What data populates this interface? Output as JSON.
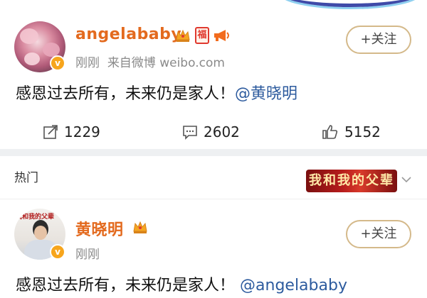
{
  "post1": {
    "username": "angelababy",
    "badge_fu": "福",
    "time": "刚刚",
    "source": "来自微博 weibo.com",
    "follow_label": "+关注",
    "text": "感恩过去所有，未来仍是家人！",
    "mention": "@黄晓明",
    "share_count": "1229",
    "comment_count": "2602",
    "like_count": "5152"
  },
  "hot_section": {
    "label": "热门",
    "banner_text": "我和我的父辈"
  },
  "post2": {
    "username": "黄晓明",
    "avatar_tag": "我和我的父辈",
    "time": "刚刚",
    "follow_label": "+关注",
    "text": "感恩过去所有，未来仍是家人！",
    "mention": "@angelababy"
  },
  "colors": {
    "username": "#e36a1e",
    "mention": "#2d5b9e",
    "follow_border": "#d4b98a",
    "verified_badge": "#f7a51c"
  },
  "icons": [
    "crown-icon",
    "megaphone-icon",
    "share-icon",
    "comment-icon",
    "like-icon",
    "chevron-down-icon",
    "verified-badge-icon"
  ]
}
